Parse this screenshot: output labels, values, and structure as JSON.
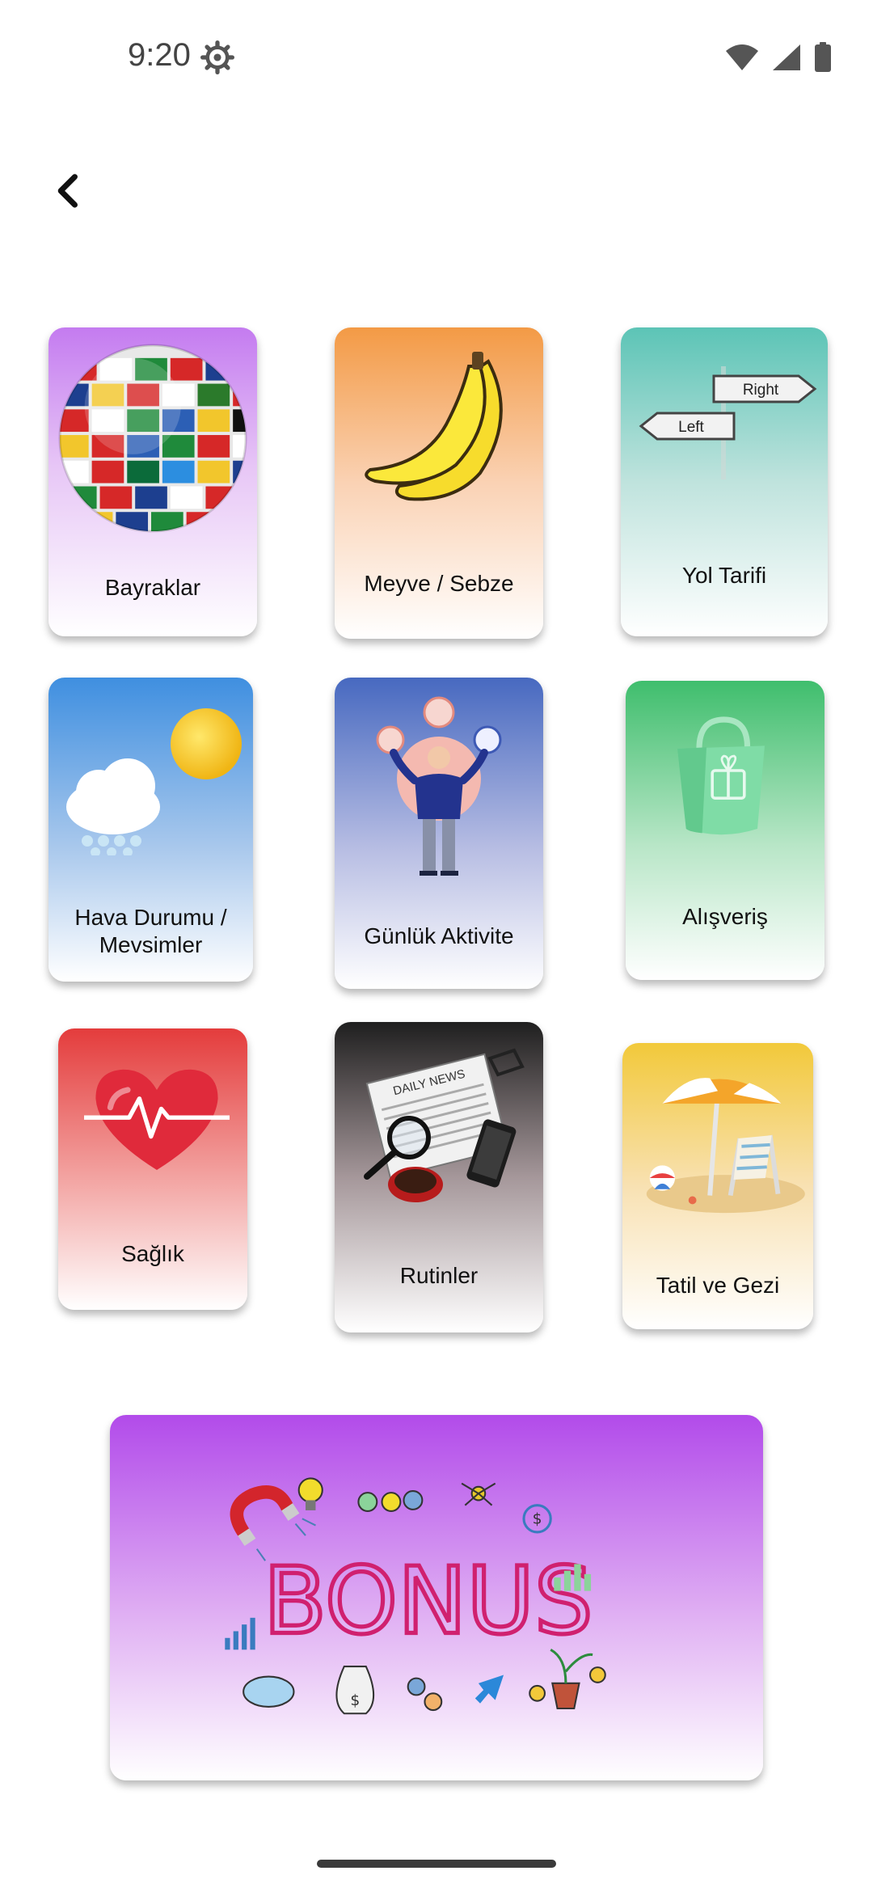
{
  "status_bar": {
    "time": "9:20",
    "icons": [
      "gear-icon",
      "wifi-icon",
      "signal-icon",
      "battery-icon"
    ]
  },
  "nav": {
    "back_icon": "chevron-left-icon"
  },
  "categories": [
    {
      "label": "Bayraklar",
      "image": "globe-flags"
    },
    {
      "label": "Meyve / Sebze",
      "image": "bananas"
    },
    {
      "label": "Yol Tarifi",
      "image": "direction-signs",
      "sign_right": "Right",
      "sign_left": "Left"
    },
    {
      "label": "Hava Durumu / Mevsimler",
      "label_line1": "Hava Durumu /",
      "label_line2": "Mevsimler",
      "image": "sun-and-snow-cloud"
    },
    {
      "label": "Günlük Aktivite",
      "image": "man-juggling-clocks"
    },
    {
      "label": "Alışveriş",
      "image": "shopping-bag"
    },
    {
      "label": "Sağlık",
      "image": "heart-pulse"
    },
    {
      "label": "Rutinler",
      "image": "newspaper-coffee-phone",
      "newspaper_title": "DAILY NEWS"
    },
    {
      "label": "Tatil ve Gezi",
      "image": "beach-umbrella-chair"
    }
  ],
  "bonus": {
    "title": "BONUS",
    "image": "bonus-doodles"
  },
  "colors": {
    "purple": "#c47bf0",
    "orange": "#f39a45",
    "teal": "#5cc4b6",
    "blue": "#3f8fe0",
    "indigo": "#4769c0",
    "green": "#3fbe6d",
    "red": "#e43c3c",
    "dark": "#1f1f1f",
    "yellow": "#f2c93a",
    "bonus": "#b24bea"
  }
}
